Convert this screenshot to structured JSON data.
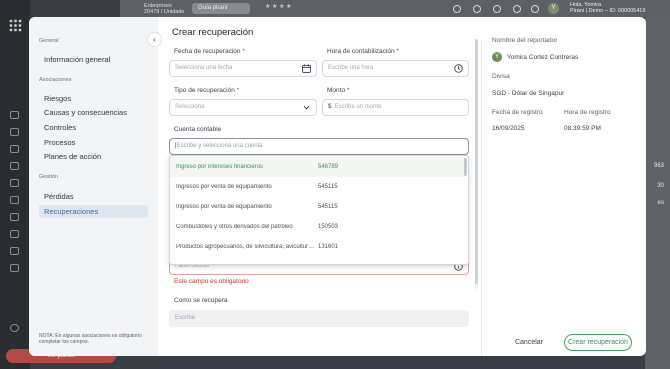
{
  "background": {
    "enterprise_label": "Enterprises",
    "enterprise_sub": "20479 / Unidade",
    "guide_badge": "Guía pirani",
    "user_greeting": "Hola, Yomira",
    "user_sub": "Pirani | Demo – ID: 000005419",
    "user_initial": "Y",
    "bottom_button": "Ver planes",
    "right_fragments": [
      "963",
      "30",
      "es"
    ],
    "colors": {
      "sidebar": "#2a2c31",
      "accent_red": "#b44a45"
    }
  },
  "modal": {
    "title": "Crear recuperación",
    "nav": {
      "general_heading": "General",
      "general_items": [
        "Información general"
      ],
      "associations_heading": "Asociaciones",
      "association_items": [
        "Riesgos",
        "Causas y consecuencias",
        "Controles",
        "Procesos",
        "Planes de acción"
      ],
      "management_heading": "Gestión",
      "management_items": [
        "Pérdidas",
        "Recuperaciones"
      ],
      "active_item": "Recuperaciones",
      "note": "NOTA: En algunas asociaciones es obligatorio completar los campos."
    },
    "form": {
      "recovery_date_label": "Fecha de recuperación",
      "recovery_date_placeholder": "Selecciona una fecha",
      "accounting_time_label": "Hora de contabilización",
      "accounting_time_placeholder": "Escribe una hora",
      "recovery_type_label": "Tipo de recuperación",
      "recovery_type_placeholder": "Selecciona",
      "amount_label": "Monto",
      "amount_prefix": "$",
      "amount_placeholder": "Escribe un monto",
      "account_label": "Cuenta contable",
      "account_placeholder": "Escribe y selecciona una cuenta",
      "hidden_field_placeholder": "Falso debido",
      "error_message": "Este campo es obligatorio",
      "how_recovered_label": "Como se recupera",
      "how_recovered_placeholder": "Escribe",
      "required_mark": "*"
    },
    "account_options": [
      {
        "name": "Ingreso por intereses financieros",
        "code": "546789",
        "selected": true
      },
      {
        "name": "Ingresos por venta de equipamiento",
        "code": "545115",
        "selected": false
      },
      {
        "name": "Ingresos por venta de equipamiento",
        "code": "545115",
        "selected": false
      },
      {
        "name": "Combustibles y otros derivados del petróleo",
        "code": "150503",
        "selected": false
      },
      {
        "name": "Productos agropecuarios, de silvicultura, avicultura y pesca",
        "code": "131601",
        "selected": false
      }
    ],
    "info": {
      "reporter_label": "Nombre del reportador",
      "reporter_name": "Yomira Cortez Contreras",
      "reporter_initial": "Y",
      "currency_label": "Divisa",
      "currency_code": "SGD",
      "currency_separator": "-",
      "currency_name": "Dólar de Singapur",
      "record_date_label": "Fecha de registro",
      "record_date": "16/09/2025",
      "record_time_label": "Hora de registro",
      "record_time": "08:39:59 PM"
    },
    "footer": {
      "cancel_label": "Cancelar",
      "create_label": "Crear recuperación"
    },
    "colors": {
      "primary_green": "#3f8a5c",
      "error_red": "#c0392b",
      "active_nav_bg": "#dde7f1"
    }
  }
}
